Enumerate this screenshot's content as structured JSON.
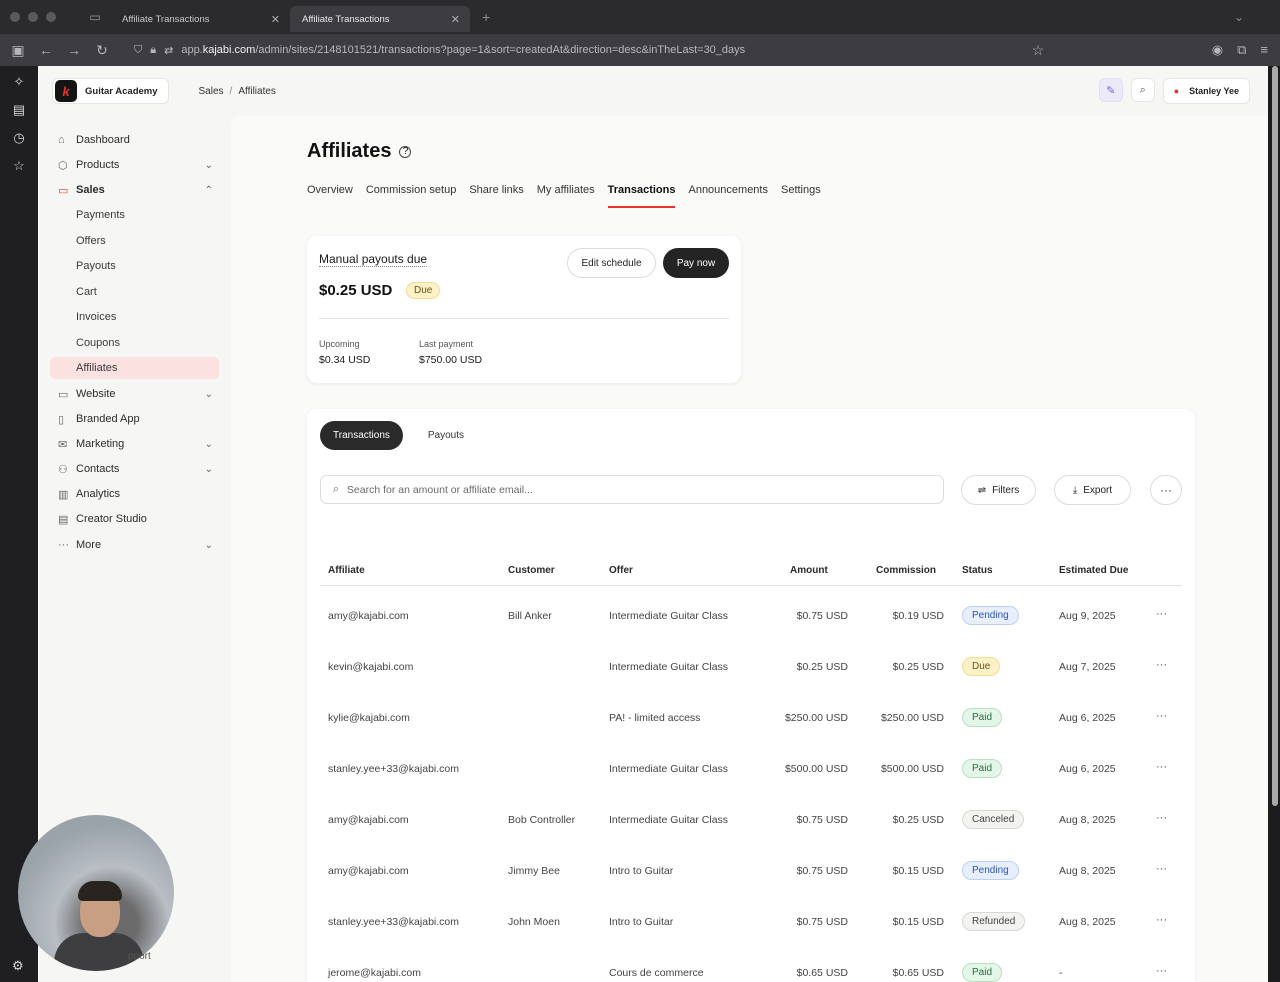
{
  "browser": {
    "tabs": [
      {
        "title": "Affiliate Transactions",
        "active": false
      },
      {
        "title": "Affiliate Transactions",
        "active": true
      }
    ],
    "url_prefix": "app.",
    "url_domain": "kajabi.com",
    "url_path": "/admin/sites/2148101521/transactions?page=1&sort=createdAt&direction=desc&inTheLast=30_days"
  },
  "topbar": {
    "site_name": "Guitar Academy",
    "logo_letter": "k",
    "breadcrumb": [
      "Sales",
      "Affiliates"
    ],
    "user_name": "Stanley Yee"
  },
  "sidebar": {
    "items": [
      {
        "label": "Dashboard",
        "icon": "home-icon",
        "chevron": ""
      },
      {
        "label": "Products",
        "icon": "box-icon",
        "chevron": "⌄"
      },
      {
        "label": "Sales",
        "icon": "card-icon",
        "chevron": "⌃"
      },
      {
        "label": "Payments"
      },
      {
        "label": "Offers"
      },
      {
        "label": "Payouts"
      },
      {
        "label": "Cart"
      },
      {
        "label": "Invoices"
      },
      {
        "label": "Coupons"
      },
      {
        "label": "Affiliates"
      },
      {
        "label": "Website",
        "icon": "monitor-icon",
        "chevron": "⌄"
      },
      {
        "label": "Branded App",
        "icon": "phone-icon",
        "chevron": ""
      },
      {
        "label": "Marketing",
        "icon": "mail-icon",
        "chevron": "⌄"
      },
      {
        "label": "Contacts",
        "icon": "contacts-icon",
        "chevron": "⌄"
      },
      {
        "label": "Analytics",
        "icon": "chart-icon",
        "chevron": ""
      },
      {
        "label": "Creator Studio",
        "icon": "studio-icon",
        "chevron": ""
      },
      {
        "label": "More",
        "icon": "dots-icon",
        "chevron": "⌄"
      }
    ],
    "support_label": "pport"
  },
  "page": {
    "title": "Affiliates",
    "tabs": [
      "Overview",
      "Commission setup",
      "Share links",
      "My affiliates",
      "Transactions",
      "Announcements",
      "Settings"
    ],
    "active_tab": "Transactions"
  },
  "payout_card": {
    "title": "Manual payouts due",
    "amount": "$0.25 USD",
    "badge": "Due",
    "edit_label": "Edit schedule",
    "pay_label": "Pay now",
    "upcoming_label": "Upcoming",
    "upcoming_value": "$0.34 USD",
    "last_label": "Last payment",
    "last_value": "$750.00 USD"
  },
  "transactions": {
    "segments": [
      "Transactions",
      "Payouts"
    ],
    "search_placeholder": "Search for an amount or affiliate email...",
    "filters_label": "Filters",
    "export_label": "Export",
    "columns": [
      "Affiliate",
      "Customer",
      "Offer",
      "Amount",
      "Commission",
      "Status",
      "Estimated Due"
    ],
    "rows": [
      {
        "affiliate": "amy@kajabi.com",
        "customer": "Bill Anker",
        "offer": "Intermediate Guitar Class",
        "amount": "$0.75 USD",
        "commission": "$0.19 USD",
        "status": "Pending",
        "due": "Aug 9, 2025"
      },
      {
        "affiliate": "kevin@kajabi.com",
        "customer": "",
        "offer": "Intermediate Guitar Class",
        "amount": "$0.25 USD",
        "commission": "$0.25 USD",
        "status": "Due",
        "due": "Aug 7, 2025"
      },
      {
        "affiliate": "kylie@kajabi.com",
        "customer": "",
        "offer": "PA! - limited access",
        "amount": "$250.00 USD",
        "commission": "$250.00 USD",
        "status": "Paid",
        "due": "Aug 6, 2025"
      },
      {
        "affiliate": "stanley.yee+33@kajabi.com",
        "customer": "",
        "offer": "Intermediate Guitar Class",
        "amount": "$500.00 USD",
        "commission": "$500.00 USD",
        "status": "Paid",
        "due": "Aug 6, 2025"
      },
      {
        "affiliate": "amy@kajabi.com",
        "customer": "Bob Controller",
        "offer": "Intermediate Guitar Class",
        "amount": "$0.75 USD",
        "commission": "$0.25 USD",
        "status": "Canceled",
        "due": "Aug 8, 2025"
      },
      {
        "affiliate": "amy@kajabi.com",
        "customer": "Jimmy Bee",
        "offer": "Intro to Guitar",
        "amount": "$0.75 USD",
        "commission": "$0.15 USD",
        "status": "Pending",
        "due": "Aug 8, 2025"
      },
      {
        "affiliate": "stanley.yee+33@kajabi.com",
        "customer": "John Moen",
        "offer": "Intro to Guitar",
        "amount": "$0.75 USD",
        "commission": "$0.15 USD",
        "status": "Refunded",
        "due": "Aug 8, 2025"
      },
      {
        "affiliate": "jerome@kajabi.com",
        "customer": "",
        "offer": "Cours de commerce",
        "amount": "$0.65 USD",
        "commission": "$0.65 USD",
        "status": "Paid",
        "due": "-"
      }
    ]
  },
  "colors": {
    "accent": "#e6342a",
    "dark_button": "#242424"
  }
}
